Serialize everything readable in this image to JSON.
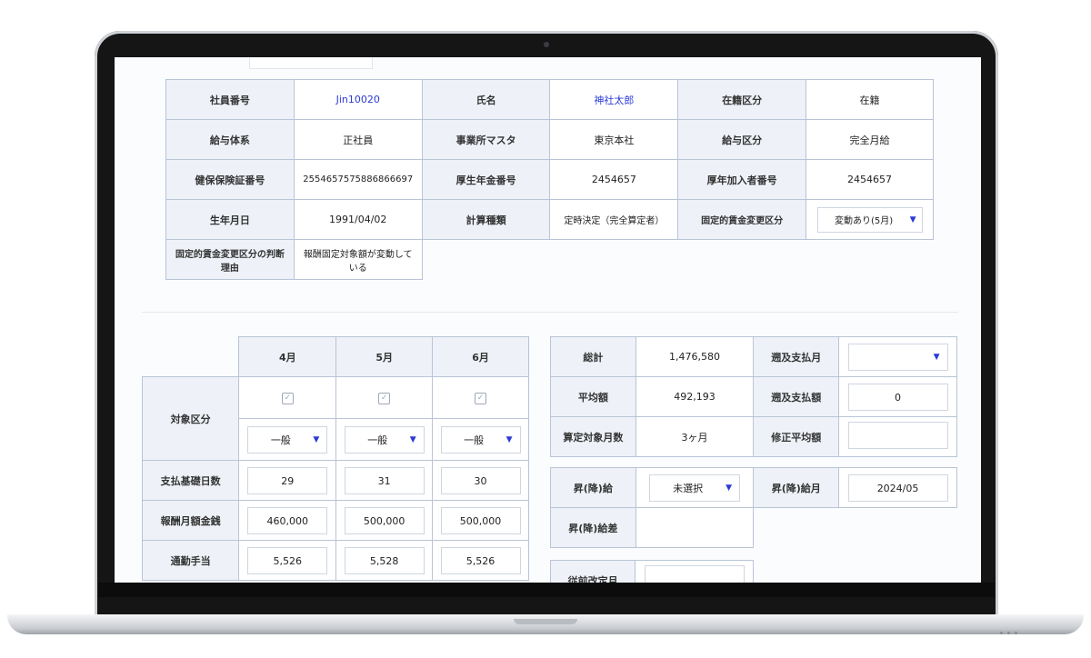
{
  "employee": {
    "rows": [
      [
        {
          "h": "社員番号"
        },
        {
          "v": "Jin10020",
          "link": true
        },
        {
          "h": "氏名"
        },
        {
          "v": "神社太郎",
          "link": true
        },
        {
          "h": "在籍区分"
        },
        {
          "v": "在籍"
        }
      ],
      [
        {
          "h": "給与体系"
        },
        {
          "v": "正社員"
        },
        {
          "h": "事業所マスタ"
        },
        {
          "v": "東京本社"
        },
        {
          "h": "給与区分"
        },
        {
          "v": "完全月給"
        }
      ],
      [
        {
          "h": "健保保険証番号"
        },
        {
          "v": "2554657575886866697"
        },
        {
          "h": "厚生年金番号"
        },
        {
          "v": "2454657"
        },
        {
          "h": "厚年加入者番号"
        },
        {
          "v": "2454657"
        }
      ]
    ],
    "birth_label": "生年月日",
    "birth_value": "1991/04/02",
    "calc_label": "計算種類",
    "calc_value": "定時決定（完全算定者）",
    "change_label": "固定的賃金変更区分",
    "change_value": "変動あり(5月)",
    "reason_label": "固定的賃金変更区分の判断理由",
    "reason_value": "報酬固定対象額が変動している"
  },
  "monthly": {
    "months": [
      "4月",
      "5月",
      "6月"
    ],
    "target_label": "対象区分",
    "checkmark": "✓",
    "category": [
      "一般",
      "一般",
      "一般"
    ],
    "rows": [
      {
        "label": "支払基礎日数",
        "values": [
          "29",
          "31",
          "30"
        ]
      },
      {
        "label": "報酬月額金銭",
        "values": [
          "460,000",
          "500,000",
          "500,000"
        ]
      },
      {
        "label": "通勤手当",
        "values": [
          "5,526",
          "5,528",
          "5,526"
        ]
      }
    ]
  },
  "summary": {
    "total_label": "総計",
    "total_value": "1,476,580",
    "retro_month_label": "遡及支払月",
    "retro_month_value": "",
    "avg_label": "平均額",
    "avg_value": "492,193",
    "retro_amount_label": "遡及支払額",
    "retro_amount_value": "0",
    "months_label": "算定対象月数",
    "months_value": "3ヶ月",
    "corrected_avg_label": "修正平均額",
    "corrected_avg_value": ""
  },
  "raise": {
    "raise_label": "昇(降)給",
    "raise_value": "未選択",
    "raise_month_label": "昇(降)給月",
    "raise_month_value": "2024/05",
    "raise_diff_label": "昇(降)給差",
    "raise_diff_value": "",
    "revision_label": "従前改定月",
    "revision_value": ""
  },
  "colors": {
    "accent": "#2b3bd6",
    "header_bg": "#eef2f8",
    "border": "#b9c4d6"
  }
}
